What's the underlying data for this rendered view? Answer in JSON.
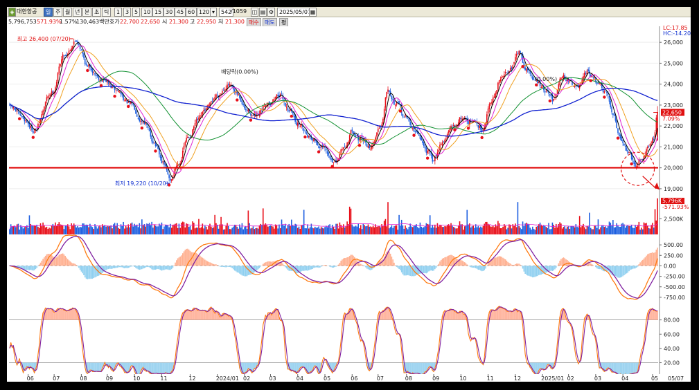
{
  "toolbar": {
    "logo_label": "대한항공",
    "periods": [
      {
        "label": "일",
        "active": true
      },
      {
        "label": "주",
        "active": false
      },
      {
        "label": "월",
        "active": false
      },
      {
        "label": "년",
        "active": false
      },
      {
        "label": "분",
        "active": false
      },
      {
        "label": "초",
        "active": false
      },
      {
        "label": "틱",
        "active": false
      }
    ],
    "intervals": [
      "1",
      "3",
      "5",
      "10",
      "15",
      "30",
      "45",
      "60",
      "120"
    ],
    "interval_selector": "▾",
    "count_value": "542",
    "total_count": "/1059",
    "date_value": "2025/05/07"
  },
  "info": {
    "volume": "5,796,753",
    "volume_ratio": "571.93%",
    "change_pct": "1.57%",
    "amount": "130,463백만",
    "hoga_label": "호가",
    "ask": "22,700",
    "bid": "22,650",
    "open_label": "시",
    "open": "21,300",
    "high_label": "고",
    "high": "22,950",
    "low_label": "저",
    "low": "21,300",
    "buy_label": "매수",
    "sell_label": "매도",
    "avg_label": "평"
  },
  "colors": {
    "up": "#e8101a",
    "down": "#1d5fe0",
    "ma5": "#000000",
    "ma10": "#e020d0",
    "ma20": "#f0a020",
    "ma60": "#109030",
    "ma120": "#1020d0",
    "support": "#e00000",
    "macd": "#ff7a10",
    "signal": "#8020a0",
    "osc_pos": "#ffb090",
    "osc_neg": "#90d0f0"
  },
  "chart_data": [
    {
      "type": "candlestick",
      "annotations": {
        "high_label": "최고 26,400 (07/20)",
        "low_label": "최저 19,220 (10/20)",
        "dividend_label_1": "배당락(0.00%)",
        "dividend_label_2": "(0.00%)",
        "lc_label": "LC:17.85",
        "hc_label": "HC:-14.20",
        "last_price": "22,650",
        "last_change": "7.09%"
      },
      "support_level": 20000,
      "ylim": [
        18700,
        26700
      ],
      "yticks": [
        19000,
        20000,
        21000,
        22000,
        23000,
        24000,
        25000,
        26000
      ],
      "ytick_labels": [
        "19,000",
        "20,000",
        "21,000",
        "22,000",
        "23,000",
        "24,000",
        "25,000",
        "26,000"
      ],
      "x_labels": [
        "06",
        "07",
        "08",
        "09",
        "10",
        "11",
        "12",
        "2024/01",
        "02",
        "03",
        "04",
        "05",
        "06",
        "07",
        "08",
        "09",
        "10",
        "11",
        "12",
        "2025/01",
        "02",
        "03",
        "04",
        "05"
      ],
      "x_tick_index": [
        15,
        36,
        58,
        79,
        101,
        123,
        146,
        168,
        190,
        211,
        233,
        255,
        277,
        298,
        321,
        343,
        365,
        387,
        409,
        431,
        452,
        474,
        496,
        520
      ],
      "x_end_label": "05/07",
      "n": 525,
      "anchors": [
        [
          0,
          22900
        ],
        [
          12,
          22300
        ],
        [
          20,
          21800
        ],
        [
          34,
          23600
        ],
        [
          44,
          25400
        ],
        [
          54,
          26100
        ],
        [
          64,
          24800
        ],
        [
          74,
          24300
        ],
        [
          86,
          23700
        ],
        [
          98,
          23000
        ],
        [
          108,
          22300
        ],
        [
          116,
          21300
        ],
        [
          124,
          20200
        ],
        [
          130,
          19400
        ],
        [
          136,
          20200
        ],
        [
          144,
          21400
        ],
        [
          152,
          22200
        ],
        [
          160,
          22800
        ],
        [
          168,
          23500
        ],
        [
          176,
          24000
        ],
        [
          184,
          23400
        ],
        [
          192,
          22700
        ],
        [
          200,
          22400
        ],
        [
          210,
          23200
        ],
        [
          218,
          23500
        ],
        [
          226,
          22800
        ],
        [
          234,
          22100
        ],
        [
          244,
          21500
        ],
        [
          252,
          21000
        ],
        [
          260,
          20400
        ],
        [
          264,
          20200
        ],
        [
          270,
          21000
        ],
        [
          278,
          21800
        ],
        [
          284,
          21300
        ],
        [
          292,
          21000
        ],
        [
          300,
          22000
        ],
        [
          306,
          23900
        ],
        [
          312,
          23100
        ],
        [
          320,
          22400
        ],
        [
          330,
          21600
        ],
        [
          338,
          20800
        ],
        [
          342,
          20300
        ],
        [
          350,
          21300
        ],
        [
          358,
          21900
        ],
        [
          366,
          22400
        ],
        [
          374,
          22200
        ],
        [
          382,
          21900
        ],
        [
          390,
          23300
        ],
        [
          398,
          24300
        ],
        [
          406,
          24900
        ],
        [
          412,
          25500
        ],
        [
          418,
          24700
        ],
        [
          426,
          24100
        ],
        [
          434,
          23600
        ],
        [
          440,
          23200
        ],
        [
          446,
          24500
        ],
        [
          452,
          24200
        ],
        [
          460,
          23800
        ],
        [
          468,
          24500
        ],
        [
          476,
          24000
        ],
        [
          482,
          23500
        ],
        [
          488,
          22600
        ],
        [
          494,
          21500
        ],
        [
          500,
          20800
        ],
        [
          506,
          20200
        ],
        [
          512,
          20600
        ],
        [
          518,
          21200
        ],
        [
          521,
          21400
        ],
        [
          524,
          22650
        ]
      ],
      "volume_levels": [
        "5,796K",
        "-571.93%",
        "2,500K"
      ],
      "volume_tick": 2500
    },
    {
      "type": "macd",
      "ylim": [
        -900,
        700
      ],
      "yticks": [
        500,
        250,
        0,
        -250,
        -500,
        -750
      ],
      "ytick_labels": [
        "500.00",
        "250.00",
        "0.00",
        "-250.00",
        "-500.00",
        "-750.00"
      ]
    },
    {
      "type": "stochastic",
      "ylim": [
        5,
        100
      ],
      "yticks": [
        80,
        60,
        40,
        20
      ],
      "ytick_labels": [
        "80.00",
        "60.00",
        "40.00",
        "20.00"
      ],
      "bands": [
        80,
        20
      ]
    }
  ]
}
